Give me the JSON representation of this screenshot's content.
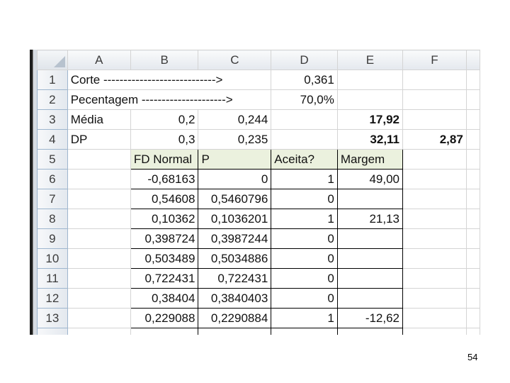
{
  "columns": [
    "A",
    "B",
    "C",
    "D",
    "E",
    "F"
  ],
  "rows": [
    {
      "n": "1",
      "A": "Corte   ---------------------------->",
      "B": "",
      "C": "",
      "D": "0,361",
      "E": "",
      "F": ""
    },
    {
      "n": "2",
      "A": "Pecentagem --------------------->",
      "B": "",
      "C": "",
      "D": "70,0%",
      "E": "",
      "F": ""
    },
    {
      "n": "3",
      "A": "Média",
      "B": "0,2",
      "C": "0,244",
      "D": "",
      "E": "17,92",
      "F": ""
    },
    {
      "n": "4",
      "A": "DP",
      "B": "0,3",
      "C": "0,235",
      "D": "",
      "E": "32,11",
      "F": "2,87"
    },
    {
      "n": "5",
      "A": "",
      "B": "FD Normal",
      "C": "P",
      "D": "Aceita?",
      "E": "Margem",
      "F": ""
    },
    {
      "n": "6",
      "A": "",
      "B": "-0,68163",
      "C": "0",
      "D": "1",
      "E": "49,00",
      "F": ""
    },
    {
      "n": "7",
      "A": "",
      "B": "0,54608",
      "C": "0,5460796",
      "D": "0",
      "E": "",
      "F": ""
    },
    {
      "n": "8",
      "A": "",
      "B": "0,10362",
      "C": "0,1036201",
      "D": "1",
      "E": "21,13",
      "F": ""
    },
    {
      "n": "9",
      "A": "",
      "B": "0,398724",
      "C": "0,3987244",
      "D": "0",
      "E": "",
      "F": ""
    },
    {
      "n": "10",
      "A": "",
      "B": "0,503489",
      "C": "0,5034886",
      "D": "0",
      "E": "",
      "F": ""
    },
    {
      "n": "11",
      "A": "",
      "B": "0,722431",
      "C": "0,722431",
      "D": "0",
      "E": "",
      "F": ""
    },
    {
      "n": "12",
      "A": "",
      "B": "0,38404",
      "C": "0,3840403",
      "D": "0",
      "E": "",
      "F": ""
    },
    {
      "n": "13",
      "A": "",
      "B": "0,229088",
      "C": "0,2290884",
      "D": "1",
      "E": "-12,62",
      "F": ""
    },
    {
      "n": "",
      "A": "",
      "B": "",
      "C": "",
      "D": "",
      "E": "",
      "F": ""
    }
  ],
  "page_number": "54"
}
